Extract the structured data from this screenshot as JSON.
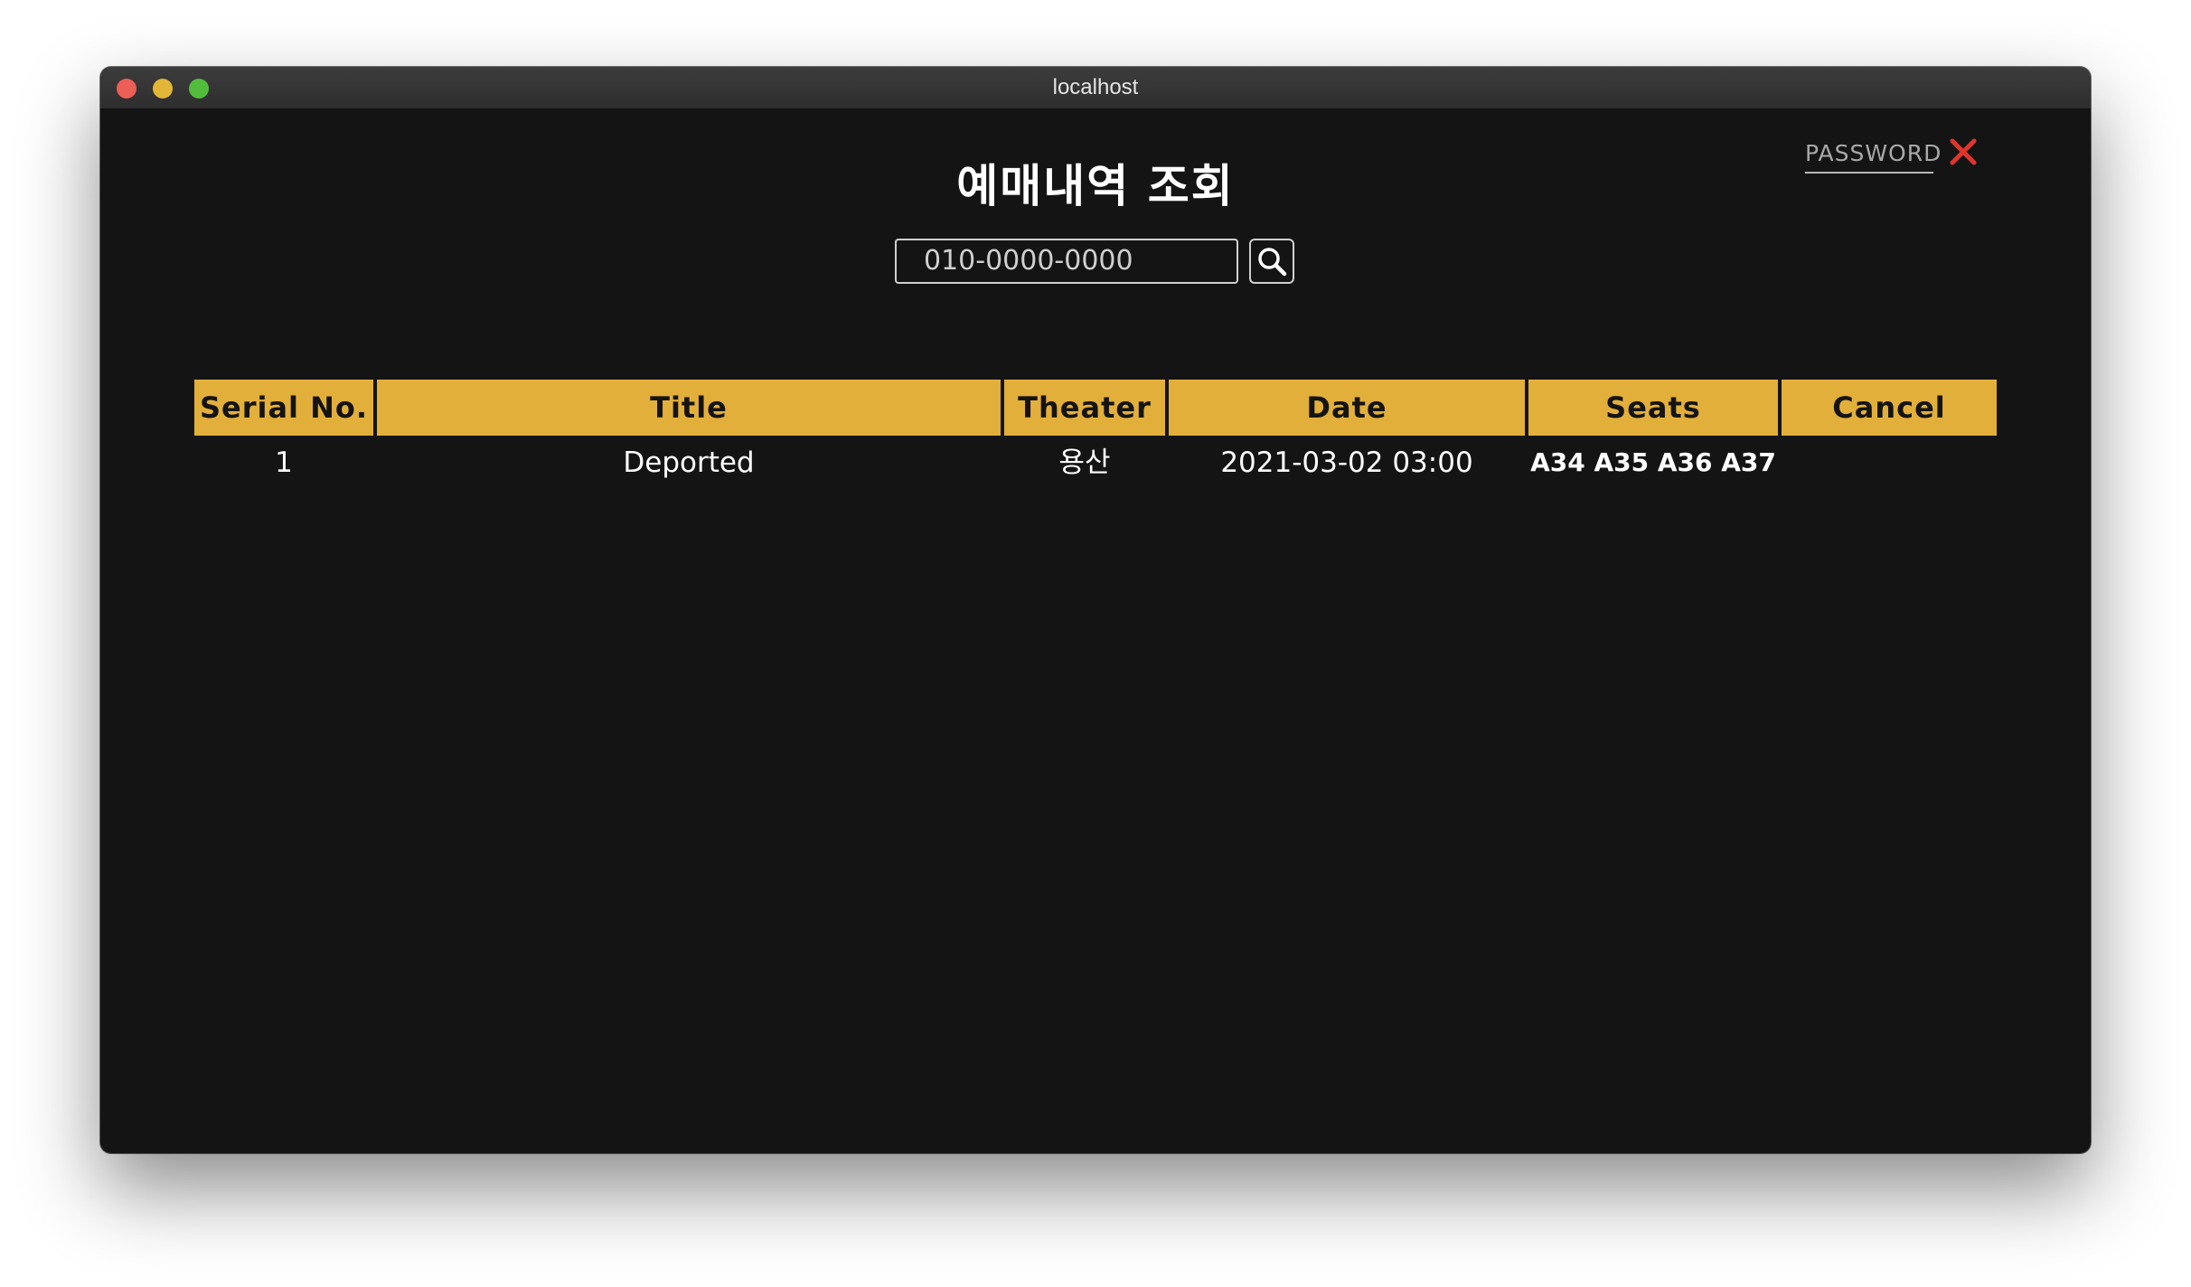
{
  "window": {
    "title": "localhost"
  },
  "page": {
    "title": "예매내역 조회"
  },
  "search": {
    "value": "010-0000-0000",
    "button_icon": "search-icon"
  },
  "table": {
    "headers": [
      "Serial No.",
      "Title",
      "Theater",
      "Date",
      "Seats",
      "Cancel"
    ],
    "rows": [
      {
        "serial": "1",
        "title": "Deported",
        "theater": "용산",
        "date": "2021-03-02 03:00",
        "seats": "A34 A35 A36 A37",
        "password_placeholder": "PASSWORD",
        "cancel_icon": "close-icon"
      }
    ]
  },
  "colors": {
    "header_bg": "#e3af3b",
    "page_bg": "#141414",
    "cancel_icon": "#e0352b"
  }
}
